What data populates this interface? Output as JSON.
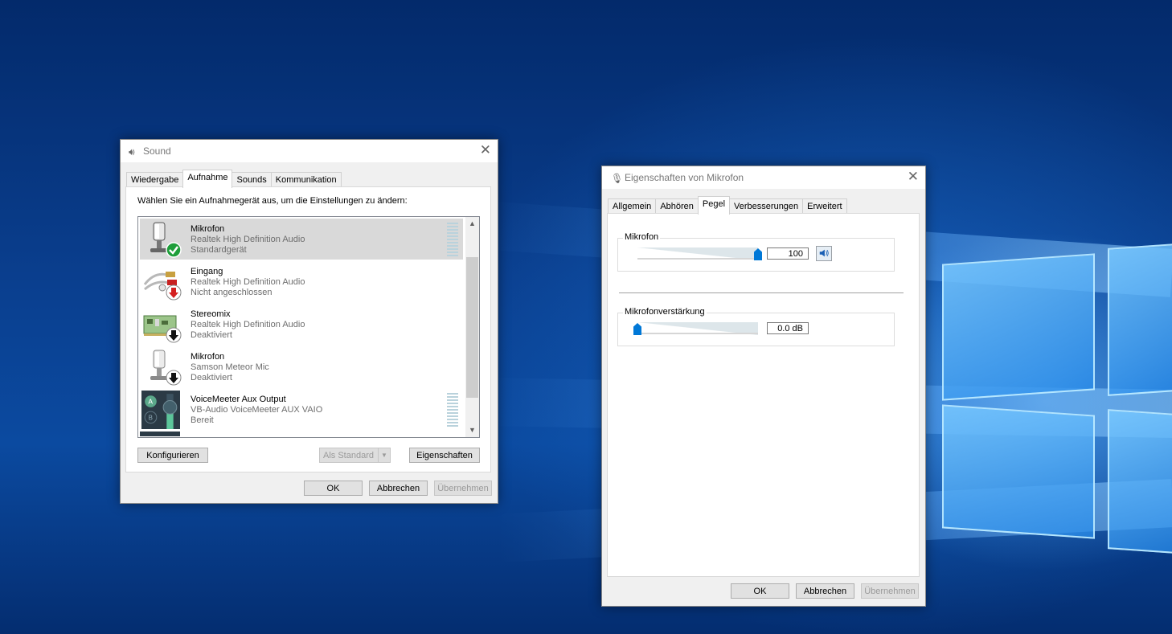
{
  "sound_window": {
    "title": "Sound",
    "tabs": [
      {
        "label": "Wiedergabe"
      },
      {
        "label": "Aufnahme"
      },
      {
        "label": "Sounds"
      },
      {
        "label": "Kommunikation"
      }
    ],
    "active_tab": "Aufnahme",
    "instruction": "Wählen Sie ein Aufnahmegerät aus, um die Einstellungen zu ändern:",
    "devices": [
      {
        "name": "Mikrofon",
        "driver": "Realtek High Definition Audio",
        "status": "Standardgerät",
        "icon": "microphone-icon",
        "badge": "check-badge-icon",
        "selected": true
      },
      {
        "name": "Eingang",
        "driver": "Realtek High Definition Audio",
        "status": "Nicht angeschlossen",
        "icon": "cable-jack-icon",
        "badge": "red-arrow-badge-icon"
      },
      {
        "name": "Stereomix",
        "driver": "Realtek High Definition Audio",
        "status": "Deaktiviert",
        "icon": "sound-card-icon",
        "badge": "down-arrow-badge-icon"
      },
      {
        "name": "Mikrofon",
        "driver": "Samson Meteor Mic",
        "status": "Deaktiviert",
        "icon": "microphone-icon",
        "badge": "down-arrow-badge-icon"
      },
      {
        "name": "VoiceMeeter Aux Output",
        "driver": "VB-Audio VoiceMeeter AUX VAIO",
        "status": "Bereit",
        "icon": "voicemeeter-icon"
      }
    ],
    "buttons": {
      "configure": "Konfigurieren",
      "set_default": "Als Standard",
      "properties": "Eigenschaften",
      "ok": "OK",
      "cancel": "Abbrechen",
      "apply": "Übernehmen"
    }
  },
  "props_window": {
    "title": "Eigenschaften von Mikrofon",
    "tabs": [
      {
        "label": "Allgemein"
      },
      {
        "label": "Abhören"
      },
      {
        "label": "Pegel"
      },
      {
        "label": "Verbesserungen"
      },
      {
        "label": "Erweitert"
      }
    ],
    "active_tab": "Pegel",
    "levels": {
      "mic_label": "Mikrofon",
      "mic_value": "100",
      "mic_level_fraction": 1.0,
      "boost_label": "Mikrofonverstärkung",
      "boost_value": "0.0 dB",
      "boost_level_fraction": 0.0
    },
    "buttons": {
      "ok": "OK",
      "cancel": "Abbrechen",
      "apply": "Übernehmen"
    }
  },
  "colors": {
    "accent": "#0078d7",
    "selected_row": "#d9d9d9",
    "check_badge": "#1e9e3a",
    "red_badge": "#d42020"
  }
}
